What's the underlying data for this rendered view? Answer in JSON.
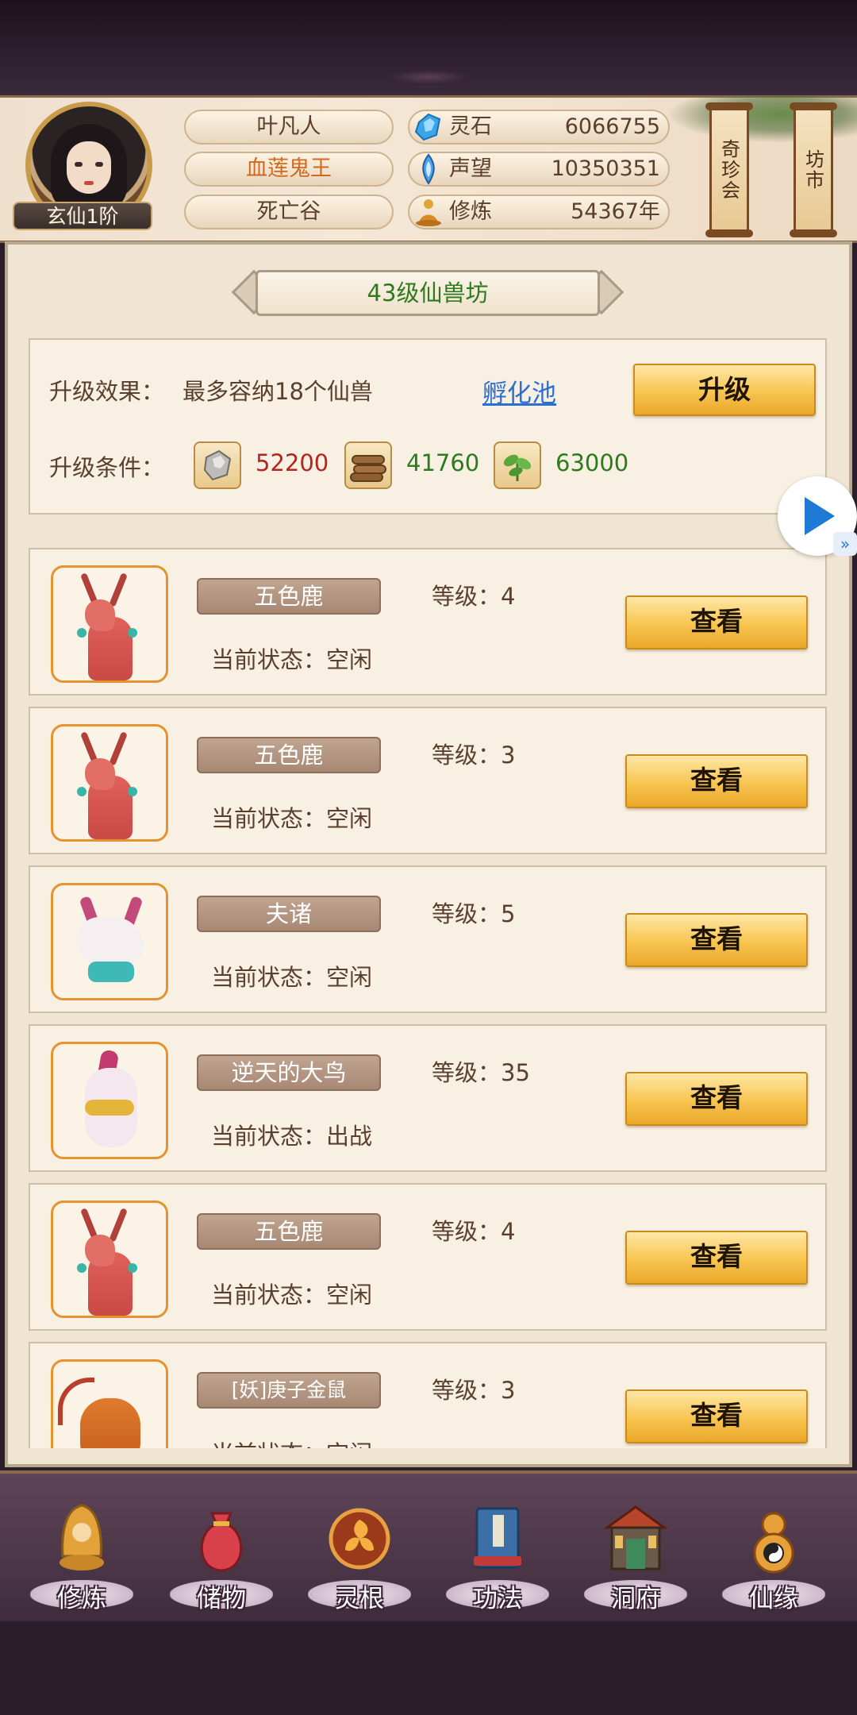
{
  "player": {
    "name": "叶凡人",
    "title": "血莲鬼王",
    "location": "死亡谷",
    "rank": "玄仙1阶"
  },
  "resources": [
    {
      "icon": "spirit-stone-icon",
      "label": "灵石",
      "value": "6066755"
    },
    {
      "icon": "reputation-icon",
      "label": "声望",
      "value": "10350351"
    },
    {
      "icon": "cultivation-icon",
      "label": "修炼",
      "value": "54367年"
    }
  ],
  "top_buttons": {
    "treasure_market": "奇珍会",
    "bazaar": "坊市"
  },
  "building": {
    "title": "43级仙兽坊",
    "effect_label": "升级效果：",
    "effect_value": "最多容纳18个仙兽",
    "hatch_link": "孵化池",
    "upgrade_button": "升级",
    "condition_label": "升级条件：",
    "materials": [
      {
        "icon": "ore-icon",
        "value": "52200"
      },
      {
        "icon": "wood-icon",
        "value": "41760"
      },
      {
        "icon": "herb-icon",
        "value": "63000"
      }
    ]
  },
  "beasts": [
    {
      "name": "五色鹿",
      "level_text": "等级：4",
      "state_text": "当前状态：空闲",
      "button": "查看",
      "art": "deer"
    },
    {
      "name": "五色鹿",
      "level_text": "等级：3",
      "state_text": "当前状态：空闲",
      "button": "查看",
      "art": "deer"
    },
    {
      "name": "夫诸",
      "level_text": "等级：5",
      "state_text": "当前状态：空闲",
      "button": "查看",
      "art": "fox"
    },
    {
      "name": "逆天的大鸟",
      "level_text": "等级：35",
      "state_text": "当前状态：出战",
      "button": "查看",
      "art": "bird"
    },
    {
      "name": "五色鹿",
      "level_text": "等级：4",
      "state_text": "当前状态：空闲",
      "button": "查看",
      "art": "deer"
    },
    {
      "name": "[妖]庚子金鼠",
      "level_text": "等级：3",
      "state_text": "当前状态：空闲",
      "button": "查看",
      "art": "rat"
    }
  ],
  "bottom_nav": [
    {
      "id": "xiulian",
      "label": "修炼",
      "icon": "monk-icon"
    },
    {
      "id": "chuwu",
      "label": "储物",
      "icon": "bag-icon"
    },
    {
      "id": "linggen",
      "label": "灵根",
      "icon": "spirit-root-icon"
    },
    {
      "id": "gongfa",
      "label": "功法",
      "icon": "book-icon"
    },
    {
      "id": "dongfu",
      "label": "洞府",
      "icon": "cave-palace-icon"
    },
    {
      "id": "xianyuan",
      "label": "仙缘",
      "icon": "gourd-icon"
    }
  ],
  "colors": {
    "gold_button": "#f7c54f",
    "title_green": "#2d7a1f",
    "cost_red": "#b5251c",
    "link_blue": "#2b6fd1",
    "player_title_orange": "#d2691e"
  }
}
